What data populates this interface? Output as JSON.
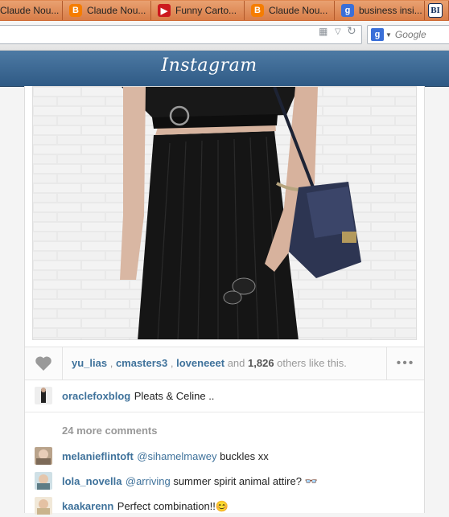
{
  "tabs": [
    {
      "label": "Claude Nou...",
      "icon": "blogger-icon"
    },
    {
      "label": "Claude Nou...",
      "icon": "blogger-icon"
    },
    {
      "label": "Funny Carto...",
      "icon": "youtube-icon"
    },
    {
      "label": "Claude Nou...",
      "icon": "blogger-icon"
    },
    {
      "label": "business insi...",
      "icon": "google-icon"
    },
    {
      "label": "BI",
      "icon": "business-insider-icon"
    }
  ],
  "search": {
    "engine_letter": "g",
    "placeholder": "Google"
  },
  "app": {
    "logo_text": "Instagram",
    "header_color": "#3f6790"
  },
  "post": {
    "likers": [
      "yu_lias",
      "cmasters3",
      "loveneeet"
    ],
    "likes_mid": " and ",
    "likes_count": "1,826",
    "likes_tail": " others like this.",
    "more_label": "•••",
    "caption_user": "oraclefoxblog",
    "caption_text": "Pleats & Celine ..",
    "more_comments_label": "24 more comments",
    "comments": [
      {
        "user": "melanieflintoft",
        "mention": "@sihamelmawey",
        "text": " buckles xx"
      },
      {
        "user": "lola_novella",
        "mention": "@arriving",
        "text": " summer spirit animal attire? 👓"
      },
      {
        "user": "kaakarenn",
        "mention": "",
        "text": "Perfect combination!!😊"
      }
    ]
  },
  "colors": {
    "link": "#3f729b",
    "muted": "#999999"
  }
}
